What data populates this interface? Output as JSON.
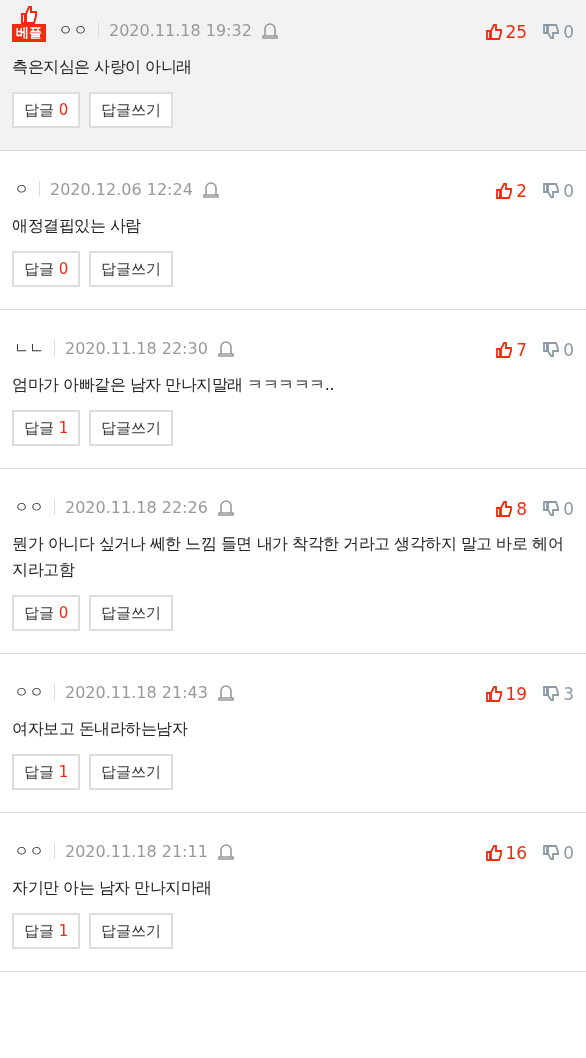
{
  "comments": [
    {
      "best": true,
      "badge": "베플",
      "author": "ㅇㅇ",
      "date": "2020.11.18 19:32",
      "text": "측은지심은 사랑이 아니래",
      "likes": "25",
      "dislikes": "0",
      "reply_label": "답글",
      "reply_count": "0",
      "write_label": "답글쓰기"
    },
    {
      "best": false,
      "author": "ㅇ",
      "date": "2020.12.06 12:24",
      "text": "애정결핍있는 사람",
      "likes": "2",
      "dislikes": "0",
      "reply_label": "답글",
      "reply_count": "0",
      "write_label": "답글쓰기"
    },
    {
      "best": false,
      "author": "ㄴㄴ",
      "date": "2020.11.18 22:30",
      "text": "엄마가 아빠같은 남자 만나지말래 ㅋㅋㅋㅋㅋ..",
      "likes": "7",
      "dislikes": "0",
      "reply_label": "답글",
      "reply_count": "1",
      "write_label": "답글쓰기"
    },
    {
      "best": false,
      "author": "ㅇㅇ",
      "date": "2020.11.18 22:26",
      "text": "뭔가 아니다 싶거나 쎄한 느낌 들면 내가 착각한 거라고 생각하지 말고 바로 헤어지라고함",
      "likes": "8",
      "dislikes": "0",
      "reply_label": "답글",
      "reply_count": "0",
      "write_label": "답글쓰기"
    },
    {
      "best": false,
      "author": "ㅇㅇ",
      "date": "2020.11.18 21:43",
      "text": "여자보고 돈내라하는남자",
      "likes": "19",
      "dislikes": "3",
      "reply_label": "답글",
      "reply_count": "1",
      "write_label": "답글쓰기"
    },
    {
      "best": false,
      "author": "ㅇㅇ",
      "date": "2020.11.18 21:11",
      "text": "자기만 아는 남자 만나지마래",
      "likes": "16",
      "dislikes": "0",
      "reply_label": "답글",
      "reply_count": "1",
      "write_label": "답글쓰기"
    }
  ]
}
